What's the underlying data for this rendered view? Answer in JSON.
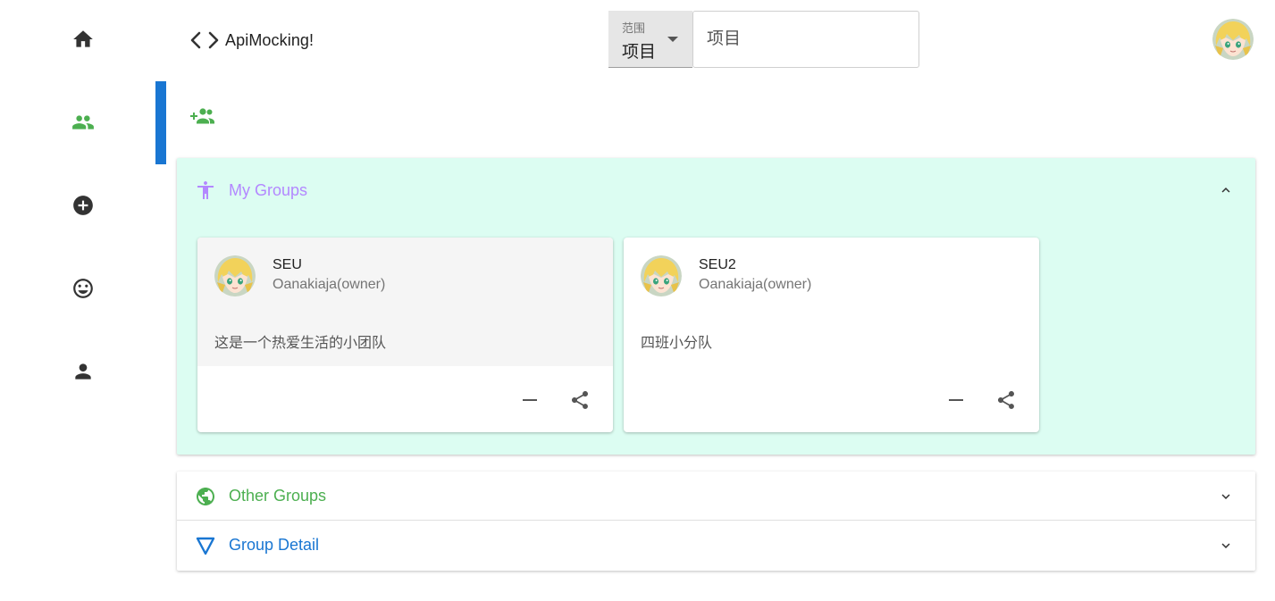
{
  "brand": {
    "title": "ApiMocking!"
  },
  "nav": {
    "items": [
      {
        "icon": "home-icon"
      },
      {
        "icon": "groups-icon",
        "active": true
      },
      {
        "icon": "add-circle-icon"
      },
      {
        "icon": "smiley-icon"
      },
      {
        "icon": "person-icon"
      }
    ],
    "active_color": "#4caf50",
    "indicator_color": "#1976d2"
  },
  "search": {
    "scope_label": "范围",
    "scope_value": "项目",
    "placeholder": "项目"
  },
  "toolbar": {
    "add_group_icon": "group-add-icon"
  },
  "panels": {
    "my_groups": {
      "title": "My Groups",
      "color": "#b388ff",
      "background": "#dcfdf2",
      "expanded": true,
      "cards": [
        {
          "name": "SEU",
          "owner": "Oanakiaja(owner)",
          "description": "这是一个热爱生活的小团队"
        },
        {
          "name": "SEU2",
          "owner": "Oanakiaja(owner)",
          "description": "四班小分队"
        }
      ]
    },
    "other_groups": {
      "title": "Other Groups",
      "color": "#4caf50",
      "expanded": false
    },
    "group_detail": {
      "title": "Group Detail",
      "color": "#1976d2",
      "expanded": false
    }
  }
}
